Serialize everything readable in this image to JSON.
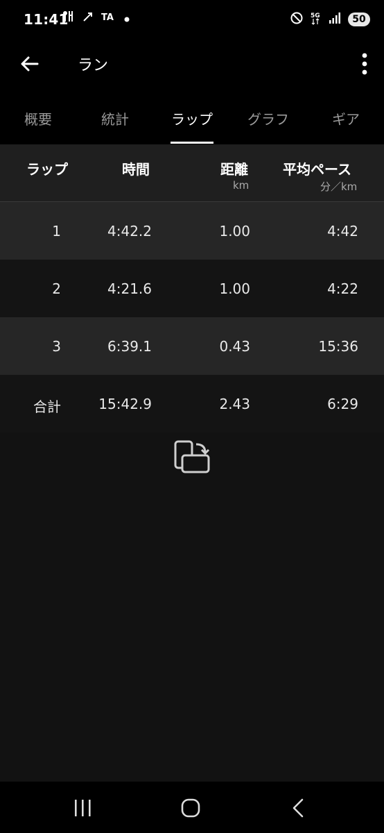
{
  "status_bar": {
    "time": "11:41",
    "left_icons": [
      "notification-icon",
      "call-icon",
      "app-icon",
      "dot-icon"
    ],
    "right_icons": [
      "dnd-icon",
      "5g-icon",
      "signal-icon"
    ],
    "battery": "50"
  },
  "app_bar": {
    "title": "ラン"
  },
  "tabs": [
    {
      "label": "概要"
    },
    {
      "label": "統計"
    },
    {
      "label": "ラップ"
    },
    {
      "label": "グラフ"
    },
    {
      "label": "ギア"
    }
  ],
  "table": {
    "headers": {
      "lap": "ラップ",
      "time": "時間",
      "distance": "距離",
      "distance_unit": "km",
      "pace": "平均ペース",
      "pace_unit": "分／km"
    },
    "rows": [
      {
        "lap": "1",
        "time": "4:42.2",
        "distance": "1.00",
        "pace": "4:42"
      },
      {
        "lap": "2",
        "time": "4:21.6",
        "distance": "1.00",
        "pace": "4:22"
      },
      {
        "lap": "3",
        "time": "6:39.1",
        "distance": "0.43",
        "pace": "15:36"
      },
      {
        "lap": "合計",
        "time": "15:42.9",
        "distance": "2.43",
        "pace": "6:29"
      }
    ]
  },
  "colors": {
    "background": "#121212",
    "header": "#1f1f1f",
    "row_alt": "#262626",
    "bar": "#000000"
  }
}
